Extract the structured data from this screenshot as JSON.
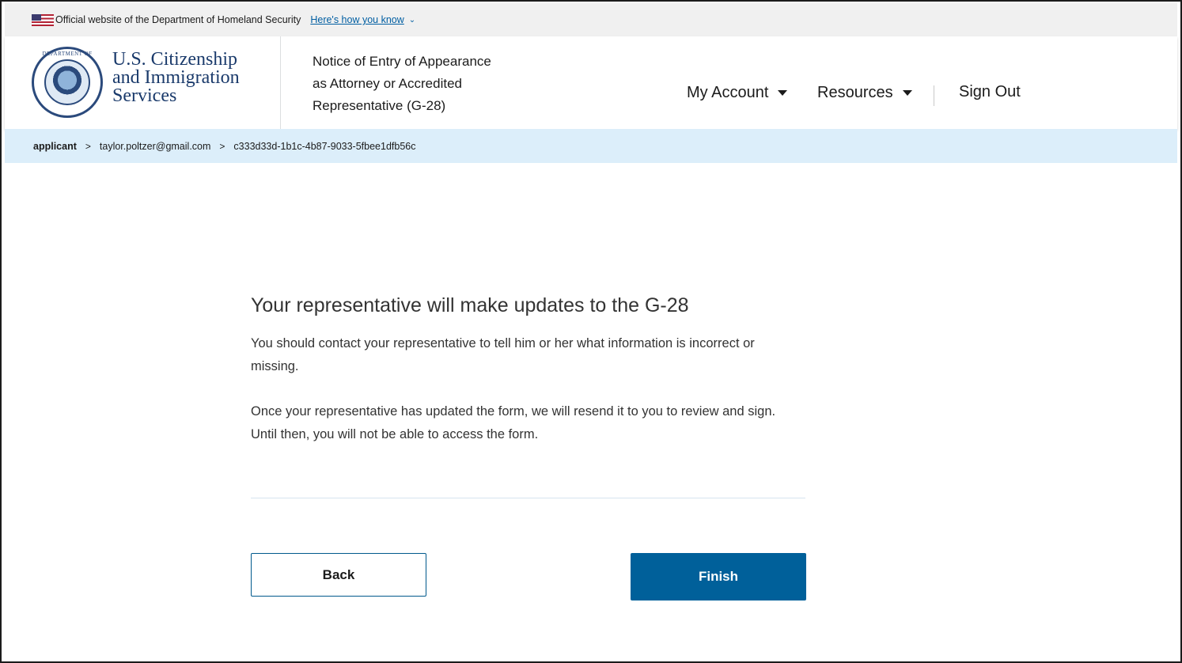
{
  "gov_banner": {
    "text": "Official website of the Department of Homeland Security",
    "link": "Here's how you know",
    "chevron_icon": "chevron-down-icon"
  },
  "header": {
    "agency_line1": "U.S. Citizenship",
    "agency_line2": "and Immigration",
    "agency_line3": "Services",
    "form_title_line1": "Notice of Entry of Appearance",
    "form_title_line2": "as Attorney or Accredited",
    "form_title_line3": "Representative (G-28)",
    "nav": {
      "my_account": "My Account",
      "resources": "Resources",
      "sign_out": "Sign Out"
    }
  },
  "breadcrumb": {
    "items": [
      "applicant",
      "taylor.poltzer@gmail.com",
      "c333d33d-1b1c-4b87-9033-5fbee1dfb56c"
    ],
    "separator": ">"
  },
  "main": {
    "heading": "Your representative will make updates to the G-28",
    "paragraph1": "You should contact your representative to tell him or her what information is incorrect or missing.",
    "paragraph2": "Once your representative has updated the form, we will resend it to you to review and sign. Until then, you will not be able to access the form.",
    "back_label": "Back",
    "finish_label": "Finish"
  },
  "colors": {
    "primary": "#00609a",
    "breadcrumb_bg": "#dceefa",
    "banner_bg": "#f0f0f0"
  }
}
